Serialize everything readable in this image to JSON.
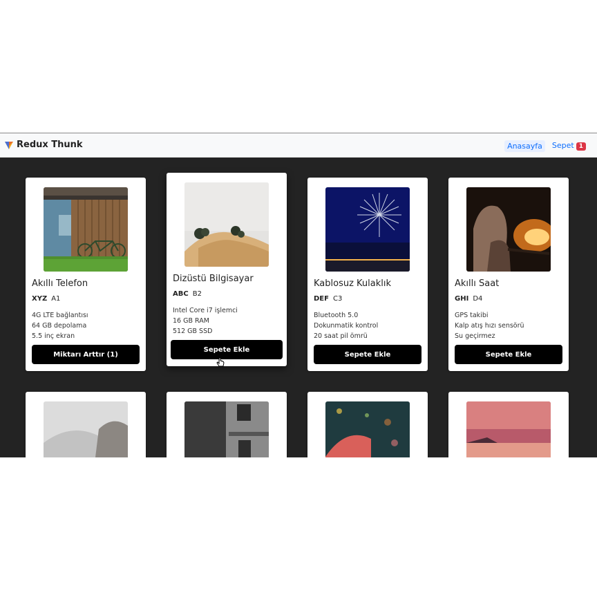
{
  "navbar": {
    "brand": "Redux Thunk",
    "home_label": "Anasayfa",
    "cart_label": "Sepet",
    "cart_count": "1"
  },
  "products": [
    {
      "title": "Akıllı Telefon",
      "brand": "XYZ",
      "model": "A1",
      "features": [
        "4G LTE bağlantısı",
        "64 GB depolama",
        "5.5 inç ekran"
      ],
      "button": "Miktarı Arttır (1)"
    },
    {
      "title": "Dizüstü Bilgisayar",
      "brand": "ABC",
      "model": "B2",
      "features": [
        "Intel Core i7 işlemci",
        "16 GB RAM",
        "512 GB SSD"
      ],
      "button": "Sepete Ekle"
    },
    {
      "title": "Kablosuz Kulaklık",
      "brand": "DEF",
      "model": "C3",
      "features": [
        "Bluetooth 5.0",
        "Dokunmatik kontrol",
        "20 saat pil ömrü"
      ],
      "button": "Sepete Ekle"
    },
    {
      "title": "Akıllı Saat",
      "brand": "GHI",
      "model": "D4",
      "features": [
        "GPS takibi",
        "Kalp atış hızı sensörü",
        "Su geçirmez"
      ],
      "button": "Sepete Ekle"
    }
  ],
  "colors": {
    "page_bg": "#232323",
    "navbar_bg": "#f8f9fa",
    "button_bg": "#000000",
    "link": "#0d6efd",
    "badge": "#dc3545"
  }
}
